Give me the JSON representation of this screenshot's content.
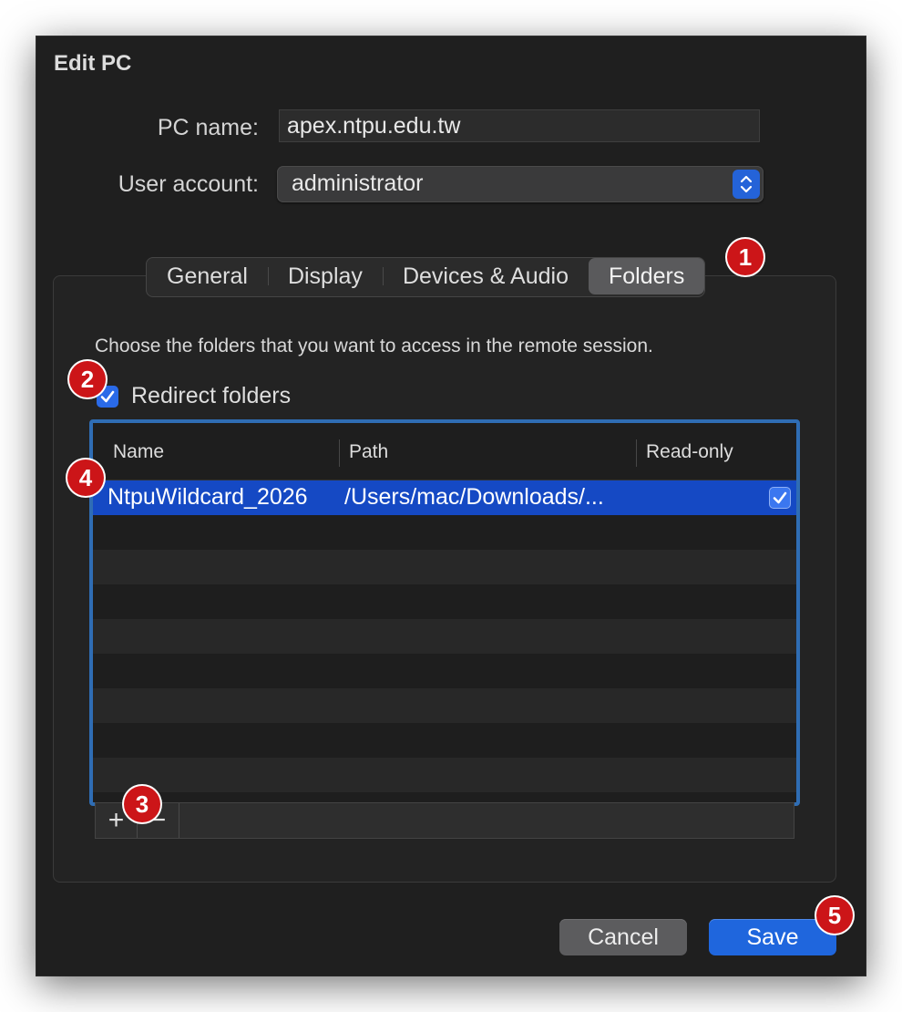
{
  "dialog": {
    "title": "Edit PC"
  },
  "form": {
    "pc_name_label": "PC name:",
    "pc_name_value": "apex.ntpu.edu.tw",
    "user_account_label": "User account:",
    "user_account_value": "administrator"
  },
  "tabs": [
    {
      "label": "General",
      "active": false
    },
    {
      "label": "Display",
      "active": false
    },
    {
      "label": "Devices & Audio",
      "active": false
    },
    {
      "label": "Folders",
      "active": true
    }
  ],
  "folders": {
    "description": "Choose the folders that you want to access in the remote session.",
    "redirect_label": "Redirect folders",
    "redirect_checked": true,
    "columns": [
      "Name",
      "Path",
      "Read-only"
    ],
    "rows": [
      {
        "name": "NtpuWildcard_2026",
        "path": "/Users/mac/Downloads/...",
        "read_only": true
      }
    ],
    "add_label": "+",
    "remove_label": "−"
  },
  "buttons": {
    "cancel": "Cancel",
    "save": "Save"
  },
  "annotations": [
    "1",
    "2",
    "3",
    "4",
    "5"
  ],
  "colors": {
    "accent": "#1f66dd",
    "badge": "#cc1518",
    "selection": "#1549c4",
    "background": "#1f1f1f"
  }
}
